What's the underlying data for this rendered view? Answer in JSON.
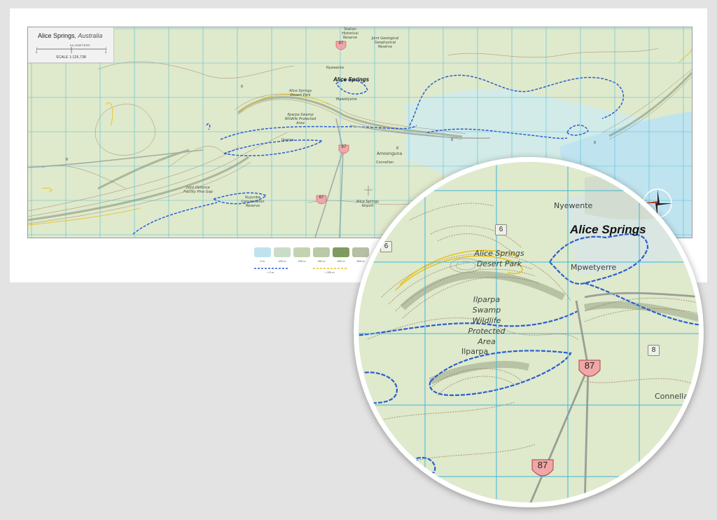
{
  "map": {
    "title_place": "Alice Springs",
    "title_region": ", Australia",
    "scale_unit": "KILOMETERS",
    "scale_ticks": [
      "5",
      "0",
      "5"
    ],
    "scale_text": "SCALE 1:126,738",
    "labels": {
      "alice_springs": "Alice Springs",
      "nyewente": "Nyewente",
      "mpwetyerre": "Mpwetyerre",
      "ilparpa_area": "Ilparpa Swamp Wildlife Protected Area",
      "ilparpa": "Ilparpa",
      "amoonguna": "Amoonguna",
      "connellan": "Connellan",
      "airport": "Alice Springs Airport",
      "joint_defence": "Joint Defence Facility Pine Gap",
      "heritage": "Station Historical Reserve",
      "geophysical": "Joint Geological Geophysical Reserve",
      "conservation": "Kuyunba Conservation Reserve",
      "park": "Alice Springs Desert Park"
    },
    "shields": [
      "87",
      "87",
      "87"
    ],
    "roads": [
      "6",
      "8",
      "8",
      "6",
      "8"
    ]
  },
  "legend": {
    "swatches": [
      {
        "label": "0 m",
        "color": "#bfe3ee"
      },
      {
        "label": "100 m",
        "color": "#c9dcc7"
      },
      {
        "label": "200 m",
        "color": "#c3d3b0"
      },
      {
        "label": "300 m",
        "color": "#b9c8a6"
      },
      {
        "label": "400 m",
        "color": "#7f9a5e"
      },
      {
        "label": "500 m",
        "color": "#b5bfa4"
      }
    ],
    "line_labels": [
      "+ 0 m",
      "+ 250 m"
    ]
  },
  "zoom": {
    "alice_springs": "Alice Springs",
    "nyewente": "Nyewente",
    "mpwetyerre": "Mpwetyerre",
    "park": "Alice Springs Desert Park",
    "ilparpa_area": "Ilparpa Swamp Wildlife Protected Area",
    "ilparpa": "Ilparpa",
    "connellan": "Connellan",
    "road_6a": "6",
    "road_6b": "6",
    "road_8": "8",
    "shield_a": "87",
    "shield_b": "87"
  },
  "colors": {
    "terrain": "#dfe9cc",
    "water": "#cfeaf0",
    "grid": "#3fb7d8",
    "boundary": "#2a5fd0",
    "contour": "#9b6b4e",
    "highlight": "#e8c21a",
    "shield": "#f1a6a8"
  }
}
